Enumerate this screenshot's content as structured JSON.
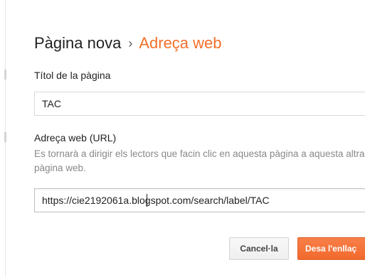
{
  "header": {
    "breadcrumb_parent": "Pàgina nova",
    "breadcrumb_separator": "›",
    "breadcrumb_current": "Adreça web",
    "accent_color": "#f26f2a"
  },
  "form": {
    "title_label": "Títol de la pàgina",
    "title_value": "TAC",
    "url_label": "Adreça web (URL)",
    "url_help": "Es tornarà a dirigir els lectors que facin clic en aquesta pàgina a aquesta altra pàgina web.",
    "url_value": "https://cie2192061a.blogspot.com/search/label/TAC"
  },
  "actions": {
    "cancel_label": "Cancel·la",
    "save_label": "Desa l'enllaç"
  }
}
